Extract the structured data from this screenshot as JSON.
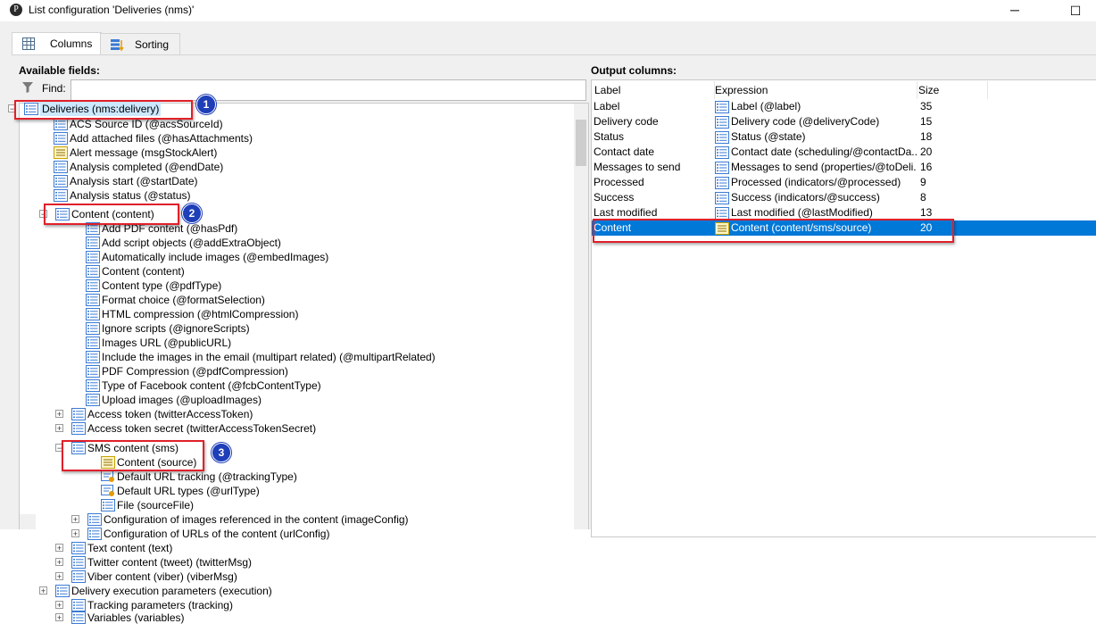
{
  "window": {
    "title": "List configuration 'Deliveries (nms)'",
    "app_icon": "P",
    "minimize_glyph": "─",
    "maximize_glyph": "☐"
  },
  "tabs": [
    {
      "label": "Columns",
      "icon": "columns-grid-icon",
      "active": true
    },
    {
      "label": "Sorting",
      "icon": "sort-icon",
      "active": false
    }
  ],
  "available_fields": {
    "label": "Available fields:",
    "find_label": "Find:",
    "find_value": "",
    "tree": [
      {
        "label": "Deliveries (nms:delivery)",
        "expander": "⊟"
      },
      {
        "label": "ACS Source ID (@acsSourceId)"
      },
      {
        "label": "Add attached files (@hasAttachments)"
      },
      {
        "label": "Alert message (msgStockAlert)"
      },
      {
        "label": "Analysis completed (@endDate)"
      },
      {
        "label": "Analysis start (@startDate)"
      },
      {
        "label": "Analysis status (@status)"
      },
      {
        "label": "Content (content)",
        "expander": "⊟"
      },
      {
        "label": "Add PDF content (@hasPdf)"
      },
      {
        "label": "Add script objects (@addExtraObject)"
      },
      {
        "label": "Automatically include images (@embedImages)"
      },
      {
        "label": "Content (content)"
      },
      {
        "label": "Content type (@pdfType)"
      },
      {
        "label": "Format choice (@formatSelection)"
      },
      {
        "label": "HTML compression (@htmlCompression)"
      },
      {
        "label": "Ignore scripts (@ignoreScripts)"
      },
      {
        "label": "Images URL (@publicURL)"
      },
      {
        "label": "Include the images in the email (multipart related) (@multipartRelated)"
      },
      {
        "label": "PDF Compression (@pdfCompression)"
      },
      {
        "label": "Type of Facebook content (@fcbContentType)"
      },
      {
        "label": "Upload images (@uploadImages)"
      },
      {
        "label": "Access token (twitterAccessToken)",
        "expander": "⊞"
      },
      {
        "label": "Access token secret (twitterAccessTokenSecret)",
        "expander": "⊞"
      },
      {
        "label": "SMS content (sms)",
        "expander": "⊟"
      },
      {
        "label": "Content (source)"
      },
      {
        "label": "Default URL tracking (@trackingType)"
      },
      {
        "label": "Default URL types (@urlType)"
      },
      {
        "label": "File (sourceFile)"
      },
      {
        "label": "Configuration of images referenced in the content (imageConfig)",
        "expander": "⊞"
      },
      {
        "label": "Configuration of URLs of the content (urlConfig)",
        "expander": "⊞"
      },
      {
        "label": "Text content (text)",
        "expander": "⊞"
      },
      {
        "label": "Twitter content (tweet) (twitterMsg)",
        "expander": "⊞"
      },
      {
        "label": "Viber content (viber) (viberMsg)",
        "expander": "⊞"
      },
      {
        "label": "Delivery execution parameters (execution)",
        "expander": "⊞"
      },
      {
        "label": "Tracking parameters (tracking)",
        "expander": "⊞"
      },
      {
        "label": "Variables (variables)",
        "expander": "⊞"
      }
    ]
  },
  "output_columns": {
    "label": "Output columns:",
    "headers": [
      "Label",
      "Expression",
      "Size"
    ],
    "rows": [
      {
        "label": "Label",
        "expression": "Label (@label)",
        "size": "35"
      },
      {
        "label": "Delivery code",
        "expression": "Delivery code (@deliveryCode)",
        "size": "15"
      },
      {
        "label": "Status",
        "expression": "Status (@state)",
        "size": "18"
      },
      {
        "label": "Contact date",
        "expression": "Contact date (scheduling/@contactDa...",
        "size": "20"
      },
      {
        "label": "Messages to send",
        "expression": "Messages to send (properties/@toDeli...",
        "size": "16"
      },
      {
        "label": "Processed",
        "expression": "Processed (indicators/@processed)",
        "size": "9"
      },
      {
        "label": "Success",
        "expression": "Success (indicators/@success)",
        "size": "8"
      },
      {
        "label": "Last modified",
        "expression": "Last modified (@lastModified)",
        "size": "13"
      },
      {
        "label": "Content",
        "expression": "Content (content/sms/source)",
        "size": "20",
        "selected": true
      }
    ]
  },
  "callouts": [
    "1",
    "2",
    "3"
  ],
  "colors": {
    "highlight": "#0078d7",
    "callout_border": "#e0202a",
    "badge": "#1f3fb8"
  }
}
